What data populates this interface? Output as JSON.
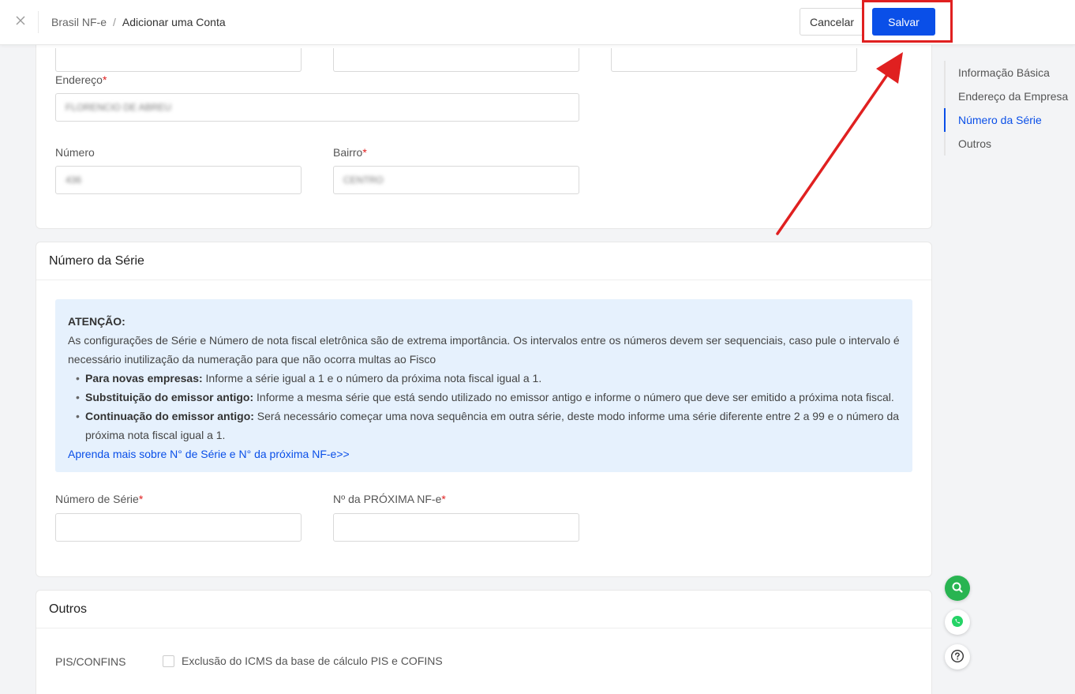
{
  "header": {
    "breadcrumb_root": "Brasil NF-e",
    "breadcrumb_separator": "/",
    "breadcrumb_current": "Adicionar uma Conta",
    "cancel_label": "Cancelar",
    "save_label": "Salvar"
  },
  "address": {
    "endereco_label": "Endereço",
    "endereco_value": "FLORENCIO DE ABREU",
    "numero_label": "Número",
    "numero_value": "436",
    "bairro_label": "Bairro",
    "bairro_value": "CENTRO"
  },
  "serie_section": {
    "title": "Número da Série",
    "notice_heading": "ATENÇÃO:",
    "notice_text": "As configurações de Série e Número de nota fiscal eletrônica são de extrema importância. Os intervalos entre os números devem ser sequenciais, caso pule o intervalo é necessário inutilização da numeração para que não ocorra multas ao Fisco",
    "bullets": [
      {
        "bold": "Para novas empresas:",
        "text": " Informe a série igual a 1 e o número da próxima nota fiscal igual a 1."
      },
      {
        "bold": "Substituição do emissor antigo:",
        "text": " Informe a mesma série que está sendo utilizado no emissor antigo e informe o número que deve ser emitido a próxima nota fiscal."
      },
      {
        "bold": "Continuação do emissor antigo:",
        "text": " Será necessário começar uma nova sequência em outra série, deste modo informe uma série diferente entre 2 a 99 e o número da próxima nota fiscal igual a 1."
      }
    ],
    "learn_more_link": "Aprenda mais sobre N° de Série e N° da próxima NF-e>>",
    "serie_label": "Número de Série",
    "proxima_label": "Nº da PRÓXIMA NF-e"
  },
  "outros_section": {
    "title": "Outros",
    "pis_label": "PIS/CONFINS",
    "checkbox_label": "Exclusão do ICMS da base de cálculo PIS e COFINS"
  },
  "side_nav": [
    {
      "label": "Informação Básica"
    },
    {
      "label": "Endereço da Empresa"
    },
    {
      "label": "Número da Série"
    },
    {
      "label": "Outros"
    }
  ],
  "colors": {
    "primary": "#0a4fe8",
    "annotation_red": "#e02020",
    "notice_bg": "#e6f1fd",
    "fab_green": "#28b451"
  },
  "icons": {
    "close": "close-icon",
    "search": "search-icon",
    "whatsapp": "whatsapp-icon",
    "help": "help-icon"
  }
}
